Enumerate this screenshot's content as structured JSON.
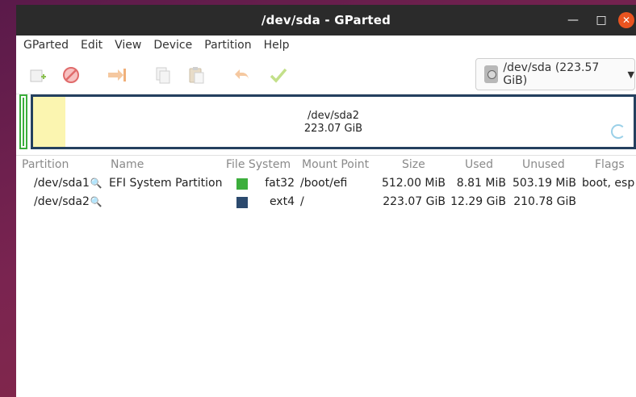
{
  "window": {
    "title": "/dev/sda - GParted"
  },
  "menu": [
    "GParted",
    "Edit",
    "View",
    "Device",
    "Partition",
    "Help"
  ],
  "toolbar": {
    "icons": [
      "new-icon",
      "delete-icon",
      "resize-move-icon",
      "copy-icon",
      "paste-icon",
      "undo-icon",
      "apply-icon"
    ],
    "device_selector": "/dev/sda (223.57 GiB)"
  },
  "diskmap": {
    "partition": "/dev/sda2",
    "size": "223.07 GiB"
  },
  "table": {
    "headers": [
      "Partition",
      "Name",
      "File System",
      "Mount Point",
      "Size",
      "Used",
      "Unused",
      "Flags"
    ],
    "rows": [
      {
        "partition": "/dev/sda1",
        "name": "EFI System Partition",
        "fs_color": "#3cae3c",
        "filesystem": "fat32",
        "mount": "/boot/efi",
        "size": "512.00 MiB",
        "used": "8.81 MiB",
        "unused": "503.19 MiB",
        "flags": "boot, esp"
      },
      {
        "partition": "/dev/sda2",
        "name": "",
        "fs_color": "#2c4a6e",
        "filesystem": "ext4",
        "mount": "/",
        "size": "223.07 GiB",
        "used": "12.29 GiB",
        "unused": "210.78 GiB",
        "flags": ""
      }
    ]
  }
}
